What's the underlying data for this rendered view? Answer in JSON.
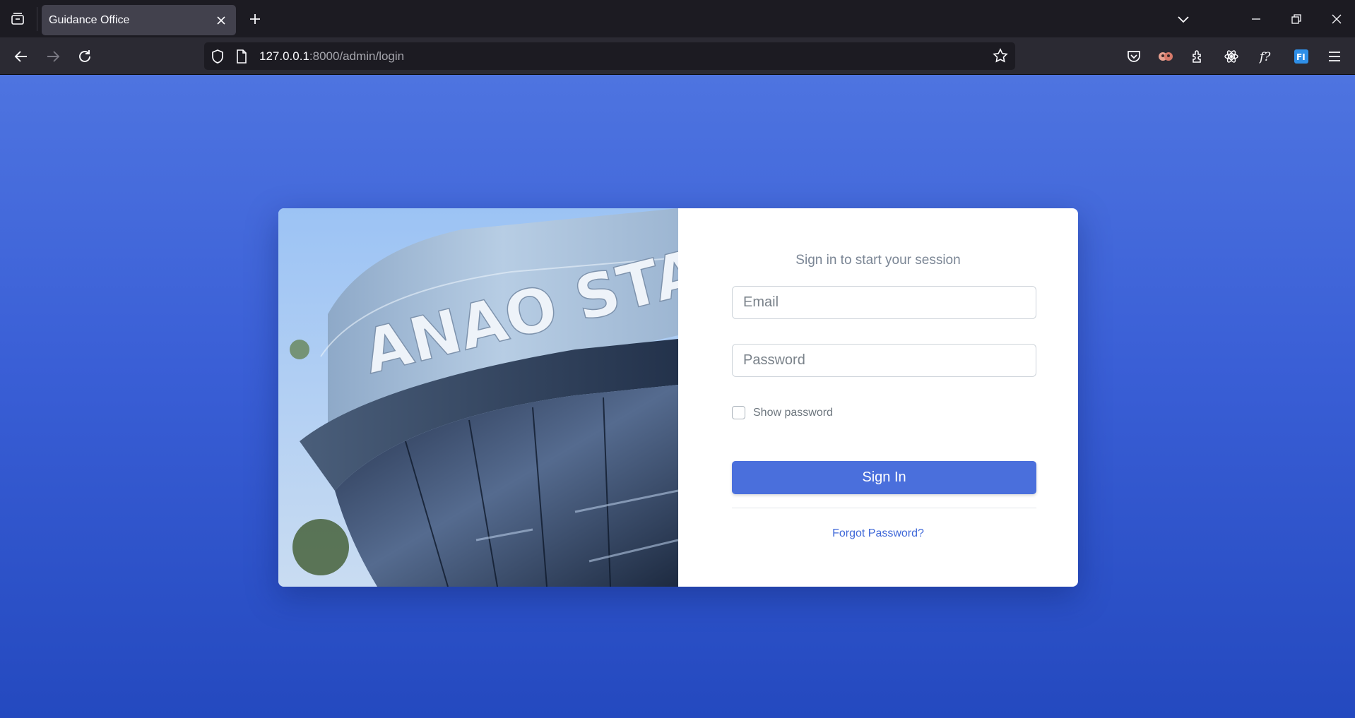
{
  "browser": {
    "tab_title": "Guidance Office",
    "url_host": "127.0.0.1",
    "url_rest": ":8000/admin/login"
  },
  "login": {
    "heading": "Sign in to start your session",
    "email_placeholder": "Email",
    "password_placeholder": "Password",
    "show_password_label": "Show password",
    "sign_in_label": "Sign In",
    "forgot_label": "Forgot Password?"
  },
  "photo": {
    "sign_text": "ANAO STATE"
  },
  "colors": {
    "accent": "#4a6fdc",
    "link": "#3f68d8",
    "page_bg_top": "#4e74e0",
    "page_bg_bottom": "#2449bf"
  }
}
